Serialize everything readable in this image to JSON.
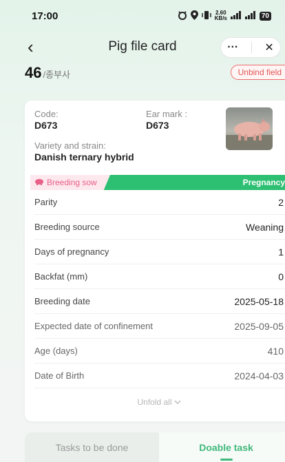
{
  "status_bar": {
    "time": "17:00",
    "icons": [
      "alarm-icon",
      "location-icon",
      "vibrate-icon",
      "network-speed",
      "signal-icon",
      "signal-5g-icon",
      "battery-icon"
    ],
    "network_speed": "2.60",
    "network_unit": "KB/s",
    "battery": "70"
  },
  "nav": {
    "back_icon": "‹",
    "title": "Pig file card",
    "more_icon": "···",
    "close_icon": "✕"
  },
  "header": {
    "pig_number": "46",
    "pig_number_suffix": "/종부사",
    "unbind_label": "Unbind field"
  },
  "card": {
    "code_label": "Code:",
    "code_value": "D673",
    "ear_mark_label": "Ear mark :",
    "ear_mark_value": "D673",
    "variety_label": "Variety and strain:",
    "variety_value": "Danish ternary hybrid",
    "status_left": "Breeding sow",
    "status_right": "Pregnancy",
    "rows": [
      {
        "label": "Parity",
        "value": "2"
      },
      {
        "label": "Breeding source",
        "value": "Weaning"
      },
      {
        "label": "Days of pregnancy",
        "value": "1"
      },
      {
        "label": "Backfat (mm)",
        "value": "0"
      },
      {
        "label": "Breeding date",
        "value": "2025-05-18"
      },
      {
        "label": "Expected date of confinement",
        "value": "2025-09-05"
      },
      {
        "label": "Age (days)",
        "value": "410"
      },
      {
        "label": "Date of Birth",
        "value": "2024-04-03"
      }
    ],
    "unfold_label": "Unfold all"
  },
  "tabs": {
    "tasks_label": "Tasks to be done",
    "doable_label": "Doable task"
  },
  "colors": {
    "accent_green": "#2dbf72",
    "tab_active": "#3fb87a",
    "unbind_red": "#e45454",
    "breeding_pink": "#e86088"
  }
}
